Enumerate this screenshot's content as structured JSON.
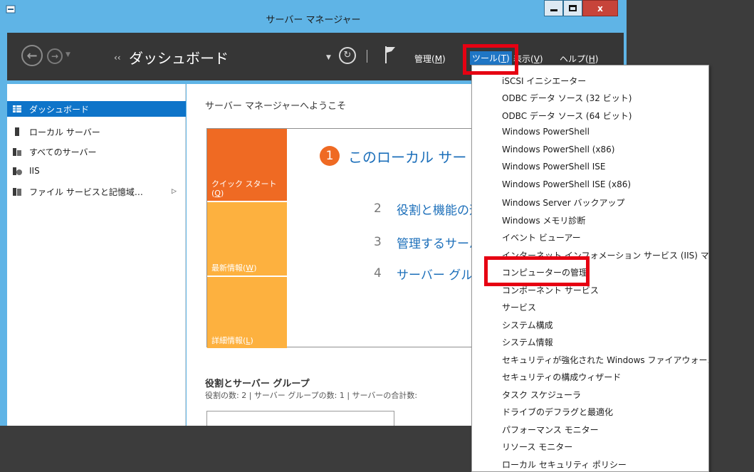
{
  "window": {
    "title": "サーバー マネージャー",
    "close_glyph": "x"
  },
  "toolbar": {
    "breadcrumb_arrows": "‹‹",
    "page_title": "ダッシュボード",
    "menus": [
      {
        "label": "管理(",
        "key": "M",
        "suffix": ")"
      },
      {
        "label": "ツール(",
        "key": "T",
        "suffix": ")"
      },
      {
        "label": "表示(",
        "key": "V",
        "suffix": ")"
      },
      {
        "label": "ヘルプ(",
        "key": "H",
        "suffix": ")"
      }
    ]
  },
  "sidebar": {
    "items": [
      {
        "label": "ダッシュボード",
        "icon": "dashboard-icon",
        "selected": true
      },
      {
        "label": "ローカル サーバー",
        "icon": "server-icon"
      },
      {
        "label": "すべてのサーバー",
        "icon": "servers-icon"
      },
      {
        "label": "IIS",
        "icon": "iis-icon"
      },
      {
        "label": "ファイル サービスと記憶域…",
        "icon": "file-services-icon"
      }
    ]
  },
  "main": {
    "welcome": "サーバー マネージャーへようこそ",
    "tiles": [
      {
        "label": "クイック スタート",
        "key": "Q"
      },
      {
        "label": "最新情報",
        "key": "W"
      },
      {
        "label": "詳細情報",
        "key": "L"
      }
    ],
    "steps": [
      {
        "num": "1",
        "text": "このローカル サー"
      },
      {
        "num": "2",
        "text": "役割と機能の追"
      },
      {
        "num": "3",
        "text": "管理するサーバー"
      },
      {
        "num": "4",
        "text": "サーバー グループ"
      }
    ],
    "roles_title": "役割とサーバー グループ",
    "roles_counts": "役割の数: 2  |  サーバー グループの数: 1  |  サーバーの合計数:"
  },
  "tools_menu": {
    "items": [
      "iSCSI イニシエーター",
      "ODBC データ ソース (32 ビット)",
      "ODBC データ ソース (64 ビット)",
      "Windows PowerShell",
      "Windows PowerShell (x86)",
      "Windows PowerShell ISE",
      "Windows PowerShell ISE (x86)",
      "Windows Server バックアップ",
      "Windows メモリ診断",
      "イベント ビューアー",
      "インターネット インフォメーション サービス (IIS) マネージャー",
      "コンピューターの管理",
      "コンポーネント サービス",
      "サービス",
      "システム構成",
      "システム情報",
      "セキュリティが強化された Windows ファイアウォール",
      "セキュリティの構成ウィザード",
      "タスク スケジューラ",
      "ドライブのデフラグと最適化",
      "パフォーマンス モニター",
      "リソース モニター",
      "ローカル セキュリティ ポリシー"
    ]
  },
  "colors": {
    "titlebar": "#5fb4e6",
    "toolbar": "#363636",
    "selection": "#0e74c9",
    "tile_orange": "#ef6a23",
    "tile_yellow": "#fdb13f",
    "link_blue": "#1c6fba",
    "highlight_red": "#e60012"
  }
}
